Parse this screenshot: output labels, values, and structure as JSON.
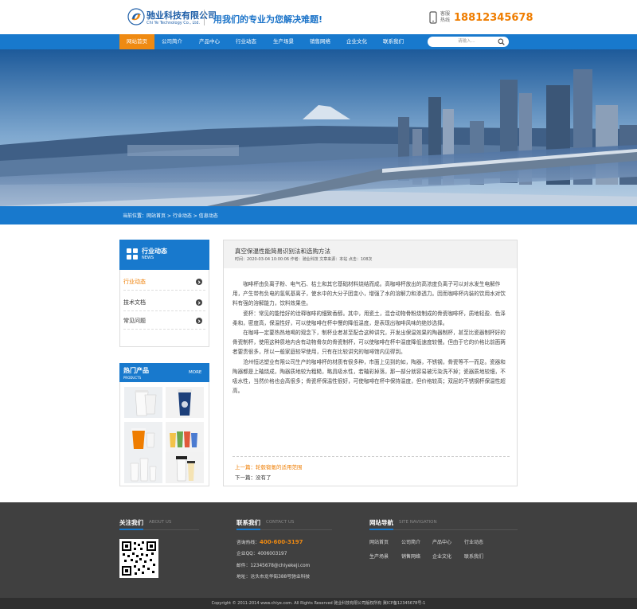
{
  "header": {
    "company_name": "驰业科技有限公司",
    "company_name_en": "Chi Ye Technology Co., Ltd.",
    "slogan": "用我们的专业为您解决难题!",
    "hotline_label": "客服热线",
    "hotline_number": "18812345678"
  },
  "nav": {
    "items": [
      "网站首页",
      "公司简介",
      "产品中心",
      "行业动态",
      "生产场景",
      "销售网络",
      "企业文化",
      "联系我们"
    ],
    "active_index": 0,
    "search_placeholder": "请输入..."
  },
  "breadcrumb": {
    "label": "当前位置：",
    "path": "网站首页 > 行业动态 > 信息动态"
  },
  "sidebar": {
    "title": "行业动态",
    "subtitle": "NEWS",
    "items": [
      "行业动态",
      "技术文档",
      "常见问题"
    ],
    "active_index": 0
  },
  "hot_products": {
    "title": "热门产品",
    "subtitle": "PRODUCTS",
    "more": "MORE"
  },
  "article": {
    "title": "真空保温性能简易识别法和选购方法",
    "meta": "时间：2020-03-04 10:00:06   作者：驰业科技   文章来源：本站   点击：108次",
    "paragraphs": [
      "咖啡杯由负离子粉、电气石、枯土和其它基础材料烧结而成。高咖啡杯放出的高浓度负离子可以对水发生电解作用，产生带有负电的氢氧基离子，使水中的大分子团变小，增强了水的溶解力和渗透力。因而咖啡杯内装的饮用水对饮料有强的溶解能力，饮料效果佳。",
      "瓷杯：常见的能恰好的诠释咖啡的细致香醇。其中，用瓷土，混合动物骨粉烧制成的骨瓷咖啡杯，质地轻盈、色泽柔和，密度高，保温性好，可以使咖啡在杯中慢的降低温度，是表现出咖啡风味的绝妙选择。",
      "在咖啡一定要热热地喝的观念下，制杯业者甚至配合这种讲究，开发出保温效果的陶器制杯，甚至比瓷器制杯好的骨瓷制杯，使用这种质地内含有动物骨灰的骨瓷制杯，可以使咖啡在杯中温度降低速度较慢。但由于它的价格比前面两者要贵很多，所以一般家庭较罕使用，只有在比较讲究的咖啡馆内见得到。",
      "沧州恒达塑业有限公司生产的咖啡杯的材质有很多种，市面上见到的如，陶器，不锈钢，骨瓷等不一而足。瓷器和陶器都是上釉烧成，陶器质地较为粗糙，略具吸水性，若釉彩掉落，那一部分就容易被污染洗不掉；瓷器质地较细，不吸水性，当然价格也会高很多；骨瓷杯保温性很好，可使咖啡在杯中保持温度，但价格较高；双层的不锈钢杯保温性超高。"
    ],
    "prev": "上一篇：轮毂锻氪的适用范围",
    "next": "下一篇：没有了"
  },
  "footer": {
    "follow": {
      "title": "关注我们",
      "subtitle": "ABOUT US"
    },
    "contact": {
      "title": "联系我们",
      "subtitle": "CONTACT US",
      "phone_label": "咨询热线：",
      "phone": "400-600-3197",
      "qq": "企业QQ：4006003197",
      "email": "邮件：12345678@chiyekeji.com",
      "address": "地址：沧头市龙华街388号驰业科技"
    },
    "sitenav": {
      "title": "网站导航",
      "subtitle": "SITE NAVIGATION",
      "items": [
        "网站首页",
        "公司简介",
        "产品中心",
        "行业动态",
        "生产场景",
        "销售网络",
        "企业文化",
        "联系我们"
      ]
    },
    "copyright": "Copyright © 2011-2014 www.chiye.com. All Rights Reserved  驰业科技有限公司版权所有 冀ICP备12345678号-1"
  },
  "colors": {
    "primary_blue": "#1879cd",
    "accent_orange": "#ef8a12",
    "footer_bg": "#404040"
  }
}
